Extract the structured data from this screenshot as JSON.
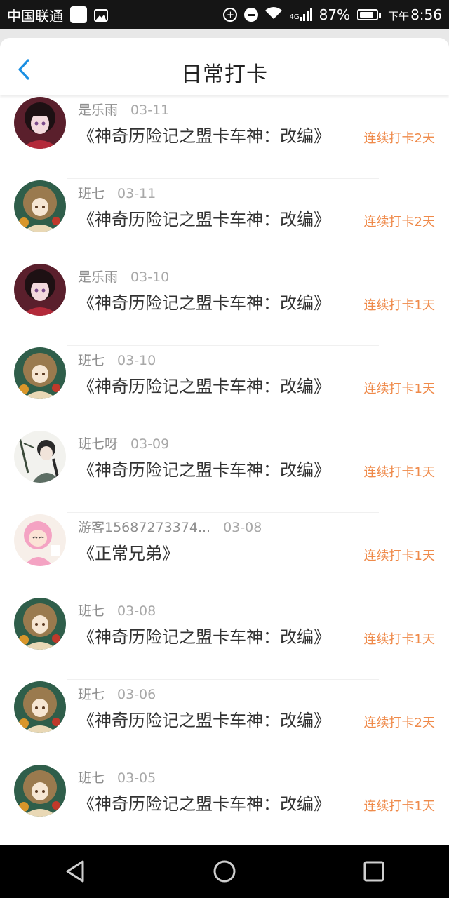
{
  "status_bar": {
    "carrier": "中国联通",
    "network": "4G",
    "battery": "87%",
    "ampm": "下午",
    "time": "8:56"
  },
  "header": {
    "title": "日常打卡",
    "back_icon": "chevron-left-icon"
  },
  "colors": {
    "accent_blue": "#1a8fe3",
    "streak_orange": "#ef8a4a",
    "status_bar_bg": "#151515"
  },
  "checkins": [
    {
      "user": "是乐雨",
      "date": "03-11",
      "book": "《神奇历险记之盟卡车神：改编》",
      "streak": "连续打卡2天",
      "avatar": "dark"
    },
    {
      "user": "班七",
      "date": "03-11",
      "book": "《神奇历险记之盟卡车神：改编》",
      "streak": "连续打卡2天",
      "avatar": "brown"
    },
    {
      "user": "是乐雨",
      "date": "03-10",
      "book": "《神奇历险记之盟卡车神：改编》",
      "streak": "连续打卡1天",
      "avatar": "dark"
    },
    {
      "user": "班七",
      "date": "03-10",
      "book": "《神奇历险记之盟卡车神：改编》",
      "streak": "连续打卡1天",
      "avatar": "brown"
    },
    {
      "user": "班七呀",
      "date": "03-09",
      "book": "《神奇历险记之盟卡车神：改编》",
      "streak": "连续打卡1天",
      "avatar": "ink"
    },
    {
      "user": "游客15687273374...",
      "date": "03-08",
      "book": "《正常兄弟》",
      "streak": "连续打卡1天",
      "avatar": "pink"
    },
    {
      "user": "班七",
      "date": "03-08",
      "book": "《神奇历险记之盟卡车神：改编》",
      "streak": "连续打卡1天",
      "avatar": "brown"
    },
    {
      "user": "班七",
      "date": "03-06",
      "book": "《神奇历险记之盟卡车神：改编》",
      "streak": "连续打卡2天",
      "avatar": "brown"
    },
    {
      "user": "班七",
      "date": "03-05",
      "book": "《神奇历险记之盟卡车神：改编》",
      "streak": "连续打卡1天",
      "avatar": "brown"
    }
  ],
  "nav_bar": {
    "back": "triangle-back-icon",
    "home": "circle-home-icon",
    "recents": "square-recents-icon"
  }
}
